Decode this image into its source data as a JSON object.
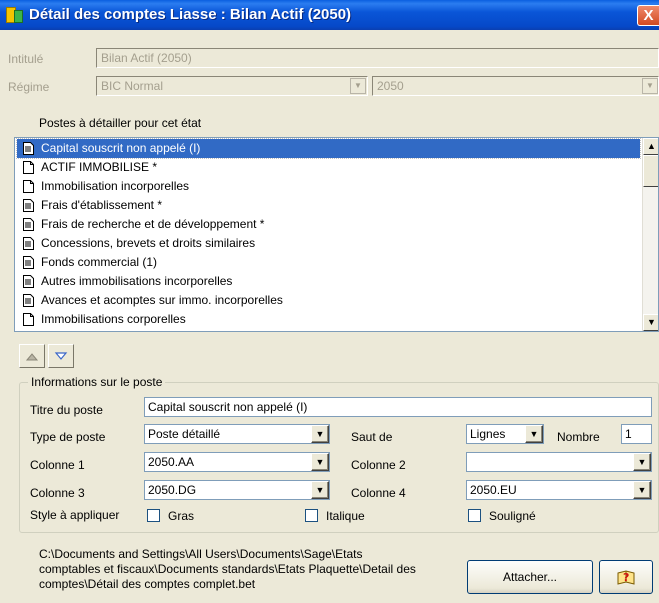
{
  "window": {
    "title": "Détail des comptes Liasse : Bilan Actif (2050)",
    "close_label": "X"
  },
  "header": {
    "intitule_label": "Intitulé",
    "intitule_value": "Bilan Actif (2050)",
    "regime_label": "Régime",
    "regime_value": "BIC Normal",
    "year_value": "2050"
  },
  "list": {
    "heading": "Postes à détailler pour cet état",
    "items": [
      {
        "label": "Capital souscrit non appelé     (I)",
        "icon": "doc-lines-icon"
      },
      {
        "label": "ACTIF IMMOBILISE  *",
        "icon": "doc-blank-icon"
      },
      {
        "label": "Immobilisation incorporelles",
        "icon": "doc-blank-icon"
      },
      {
        "label": "Frais d'établissement *",
        "icon": "doc-lines-icon"
      },
      {
        "label": "Frais de recherche et de développement *",
        "icon": "doc-lines-icon"
      },
      {
        "label": "Concessions, brevets et droits similaires",
        "icon": "doc-lines-icon"
      },
      {
        "label": "Fonds commercial (1)",
        "icon": "doc-lines-icon"
      },
      {
        "label": "Autres immobilisations incorporelles",
        "icon": "doc-lines-icon"
      },
      {
        "label": "Avances et acomptes sur immo. incorporelles",
        "icon": "doc-lines-icon"
      },
      {
        "label": "Immobilisations corporelles",
        "icon": "doc-blank-icon"
      }
    ]
  },
  "poste": {
    "group_title": "Informations sur le poste",
    "titre_label": "Titre du poste",
    "titre_value": "Capital souscrit non appelé     (I)",
    "type_label": "Type de poste",
    "type_value": "Poste détaillé",
    "saut_label": "Saut de",
    "saut_value": "Lignes",
    "nombre_label": "Nombre",
    "nombre_value": "1",
    "col1_label": "Colonne 1",
    "col1_value": "2050.AA",
    "col2_label": "Colonne 2",
    "col2_value": "",
    "col3_label": "Colonne 3",
    "col3_value": "2050.DG",
    "col4_label": "Colonne 4",
    "col4_value": "2050.EU",
    "style_label": "Style à appliquer",
    "gras_label": "Gras",
    "italique_label": "Italique",
    "souligne_label": "Souligné"
  },
  "footer": {
    "path_line1": "C:\\Documents and Settings\\All Users\\Documents\\Sage\\Etats",
    "path_line2": "comptables et fiscaux\\Documents standards\\Etats Plaquette\\Detail des",
    "path_line3": "comptes\\Détail des comptes complet.bet",
    "attach_label": "Attacher...",
    "help_icon": "help-book-icon"
  },
  "colors": {
    "selection": "#316ac5",
    "titlebar": "#0a56d8",
    "face": "#ece9d8"
  }
}
